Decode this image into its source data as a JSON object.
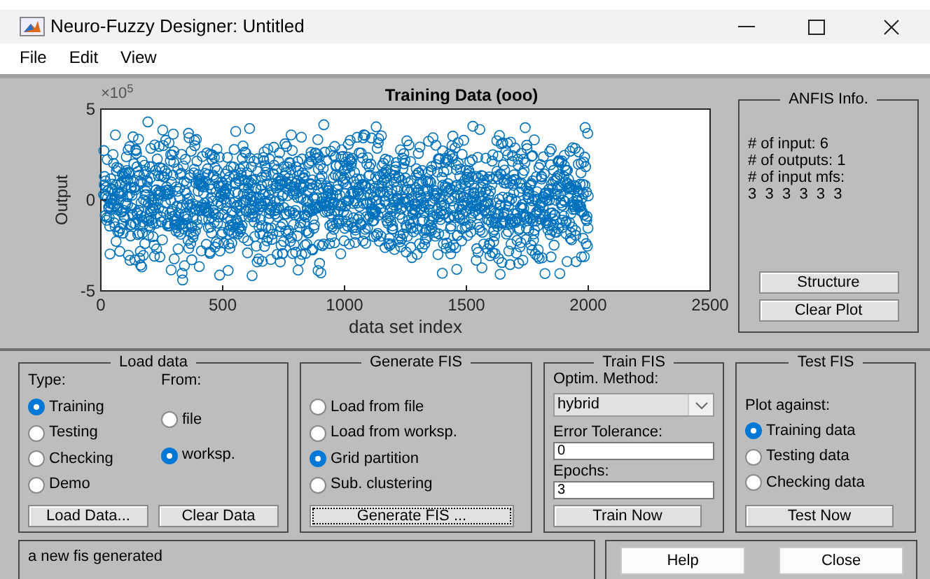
{
  "window": {
    "title": "Neuro-Fuzzy Designer: Untitled"
  },
  "menu": [
    "File",
    "Edit",
    "View"
  ],
  "plot": {
    "title": "Training Data (ooo)",
    "xlabel": "data set index",
    "ylabel": "Output",
    "multiplier": "×10$^{5}$",
    "x_tick_labels": [
      "0",
      "500",
      "1000",
      "1500",
      "2000",
      "2500"
    ],
    "y_tick_labels": [
      "5",
      "0",
      "-5"
    ]
  },
  "anfis_info": {
    "title": "ANFIS Info.",
    "lines": [
      "# of input: 6",
      "# of outputs: 1",
      "# of input mfs:",
      "3  3  3  3  3  3"
    ],
    "buttons": [
      "Structure",
      "Clear Plot"
    ]
  },
  "load_data": {
    "title": "Load data",
    "type_label": "Type:",
    "types": [
      {
        "label": "Training",
        "selected": true
      },
      {
        "label": "Testing",
        "selected": false
      },
      {
        "label": "Checking",
        "selected": false
      },
      {
        "label": "Demo",
        "selected": false
      }
    ],
    "from_label": "From:",
    "sources": [
      {
        "label": "file",
        "selected": false
      },
      {
        "label": "worksp.",
        "selected": true
      }
    ],
    "buttons": [
      "Load Data...",
      "Clear Data"
    ]
  },
  "generate_fis": {
    "title": "Generate FIS",
    "options": [
      {
        "label": "Load from file",
        "selected": false
      },
      {
        "label": "Load from worksp.",
        "selected": false
      },
      {
        "label": "Grid partition",
        "selected": true
      },
      {
        "label": "Sub. clustering",
        "selected": false
      }
    ],
    "button": {
      "label": "Generate FIS ...",
      "focused": true
    }
  },
  "train_fis": {
    "title": "Train FIS",
    "method_label": "Optim. Method:",
    "method": "hybrid",
    "tolerance_label": "Error Tolerance:",
    "tolerance": "0",
    "epochs_label": "Epochs:",
    "epochs": "3",
    "button": "Train Now"
  },
  "test_fis": {
    "title": "Test FIS",
    "plot_label": "Plot against:",
    "options": [
      {
        "label": "Training data",
        "selected": true
      },
      {
        "label": "Testing data",
        "selected": false
      },
      {
        "label": "Checking data",
        "selected": false
      }
    ],
    "button": "Test Now"
  },
  "status": "a new fis generated",
  "buttons": [
    "Help",
    "Close"
  ]
}
